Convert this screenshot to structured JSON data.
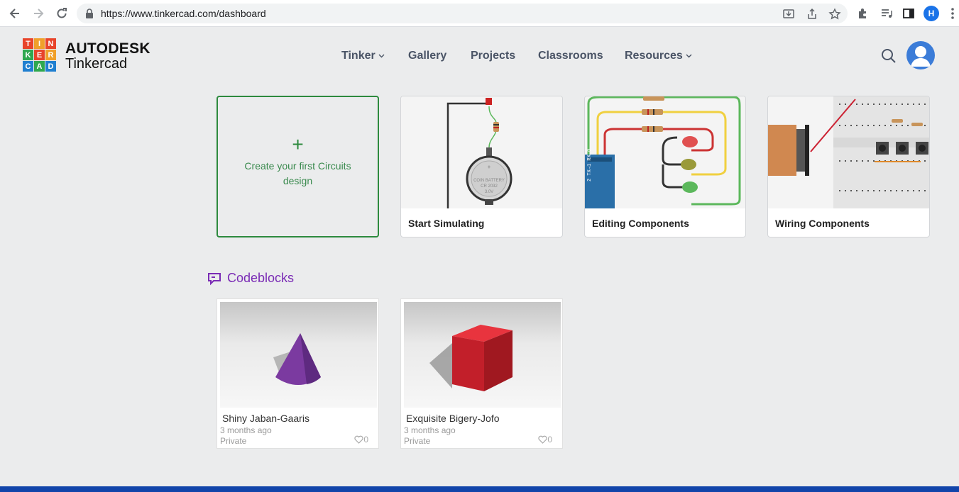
{
  "browser": {
    "url": "https://www.tinkercad.com/dashboard",
    "profile_initial": "H"
  },
  "header": {
    "logo_letters": [
      "T",
      "I",
      "N",
      "K",
      "E",
      "R",
      "C",
      "A",
      "D"
    ],
    "brand_line1": "AUTODESK",
    "brand_line2": "Tinkercad",
    "nav": [
      "Tinker",
      "Gallery",
      "Projects",
      "Classrooms",
      "Resources"
    ]
  },
  "circuits": {
    "create_label": "Create your first Circuits design",
    "create_plus": "+",
    "tutorials": [
      "Start Simulating",
      "Editing Components",
      "Wiring Components"
    ]
  },
  "codeblocks": {
    "section_title": "Codeblocks",
    "designs": [
      {
        "name": "Shiny Jaban-Gaaris",
        "age": "3 months ago",
        "visibility": "Private",
        "likes": "0",
        "shape": "cone",
        "color": "#7b3aa0"
      },
      {
        "name": "Exquisite Bigery-Jofo",
        "age": "3 months ago",
        "visibility": "Private",
        "likes": "0",
        "shape": "cube",
        "color": "#cc1f2a"
      }
    ]
  },
  "colors": {
    "accent_green": "#2d8a3e",
    "codeblocks_purple": "#7a2bb5",
    "footer_blue": "#1144aa"
  }
}
